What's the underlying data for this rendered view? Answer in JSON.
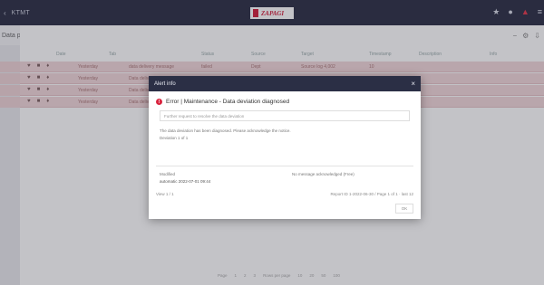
{
  "topbar": {
    "back": "‹",
    "app_title": "KTMT",
    "logo": "ZAPAGI",
    "icons": [
      "apps-icon",
      "info-icon",
      "alert-icon",
      "user-icon"
    ]
  },
  "page": {
    "title": "Data processing",
    "head_icons": [
      "−",
      "⚙",
      "⇩"
    ],
    "columns": [
      "Date",
      "Tab",
      "Status",
      "Source",
      "Target",
      "Timestamp",
      "Description",
      "Info"
    ],
    "rows": [
      {
        "date": "Yesterday",
        "tab": "data delivery message",
        "status": "failed",
        "source": "Dept",
        "target": "Source log 4,002",
        "ts": "10"
      },
      {
        "date": "Yesterday",
        "tab": "Data delivery",
        "status": "",
        "source": "",
        "target": "",
        "ts": ""
      },
      {
        "date": "Yesterday",
        "tab": "Data delivery",
        "status": "",
        "source": "",
        "target": "",
        "ts": ""
      },
      {
        "date": "Yesterday",
        "tab": "Data delivery",
        "status": "",
        "source": "",
        "target": "",
        "ts": ""
      }
    ]
  },
  "modal": {
    "title": "Alert info",
    "close": "×",
    "error_text": "Error | Maintenance - Data deviation diagnosed",
    "message": "Further request to resolve the data deviation",
    "description": "The data deviation has been diagnosed. Please acknowledge the notice.",
    "description2": "Deviation 1 of 1",
    "modified_label": "Modified",
    "modified_value": "automatic 2022-07-01 09:44",
    "right_note": "No message acknowledged (Free)",
    "footer_left": "View 1 / 1",
    "footer_right": "Report ID 1-2022-06-30 / Page 1 of 1 · last 12",
    "ok": "OK"
  },
  "pager": [
    "Page",
    "1",
    "2",
    "3",
    "Rows per page",
    "10",
    "20",
    "50",
    "100"
  ]
}
